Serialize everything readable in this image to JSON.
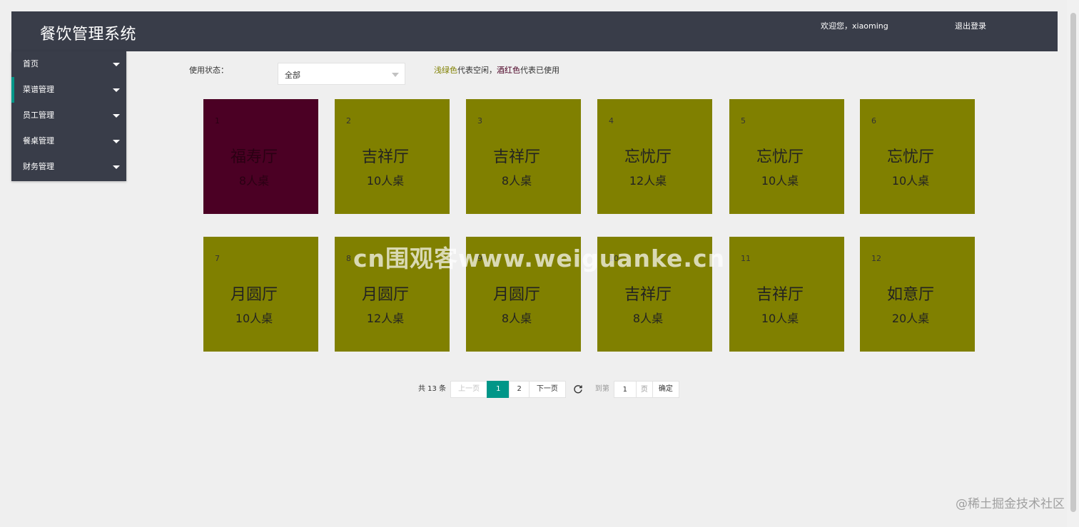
{
  "header": {
    "title": "餐饮管理系统",
    "welcome": "欢迎您，xiaoming",
    "logout": "退出登录"
  },
  "sidebar": {
    "items": [
      {
        "label": "首页"
      },
      {
        "label": "菜谱管理"
      },
      {
        "label": "员工管理"
      },
      {
        "label": "餐桌管理"
      },
      {
        "label": "财务管理"
      }
    ]
  },
  "filter": {
    "label": "使用状态：",
    "selected": "全部",
    "legend_green": "浅绿色",
    "legend_mid": "代表空闲，",
    "legend_red": "酒红色",
    "legend_end": "代表已使用"
  },
  "colors": {
    "free": "#808000",
    "used": "#4b0024",
    "accent": "#009688",
    "header_bg": "#393d49"
  },
  "tables": [
    {
      "num": "1",
      "hall": "福寿厅",
      "seats": "8人桌",
      "status": "used"
    },
    {
      "num": "2",
      "hall": "吉祥厅",
      "seats": "10人桌",
      "status": "free"
    },
    {
      "num": "3",
      "hall": "吉祥厅",
      "seats": "8人桌",
      "status": "free"
    },
    {
      "num": "4",
      "hall": "忘忧厅",
      "seats": "12人桌",
      "status": "free"
    },
    {
      "num": "5",
      "hall": "忘忧厅",
      "seats": "10人桌",
      "status": "free"
    },
    {
      "num": "6",
      "hall": "忘忧厅",
      "seats": "10人桌",
      "status": "free"
    },
    {
      "num": "7",
      "hall": "月圆厅",
      "seats": "10人桌",
      "status": "free"
    },
    {
      "num": "8",
      "hall": "月圆厅",
      "seats": "12人桌",
      "status": "free"
    },
    {
      "num": "9",
      "hall": "月圆厅",
      "seats": "8人桌",
      "status": "free"
    },
    {
      "num": "10",
      "hall": "吉祥厅",
      "seats": "8人桌",
      "status": "free"
    },
    {
      "num": "11",
      "hall": "吉祥厅",
      "seats": "10人桌",
      "status": "free"
    },
    {
      "num": "12",
      "hall": "如意厅",
      "seats": "20人桌",
      "status": "free"
    }
  ],
  "pagination": {
    "total": "共 13 条",
    "prev": "上一页",
    "pages": [
      "1",
      "2"
    ],
    "current": "1",
    "next": "下一页",
    "goto": "到第",
    "goto_value": "1",
    "unit": "页",
    "confirm": "确定"
  },
  "watermarks": {
    "center": "cn围观客www.weiguanke.cn",
    "corner": "@稀土掘金技术社区"
  }
}
